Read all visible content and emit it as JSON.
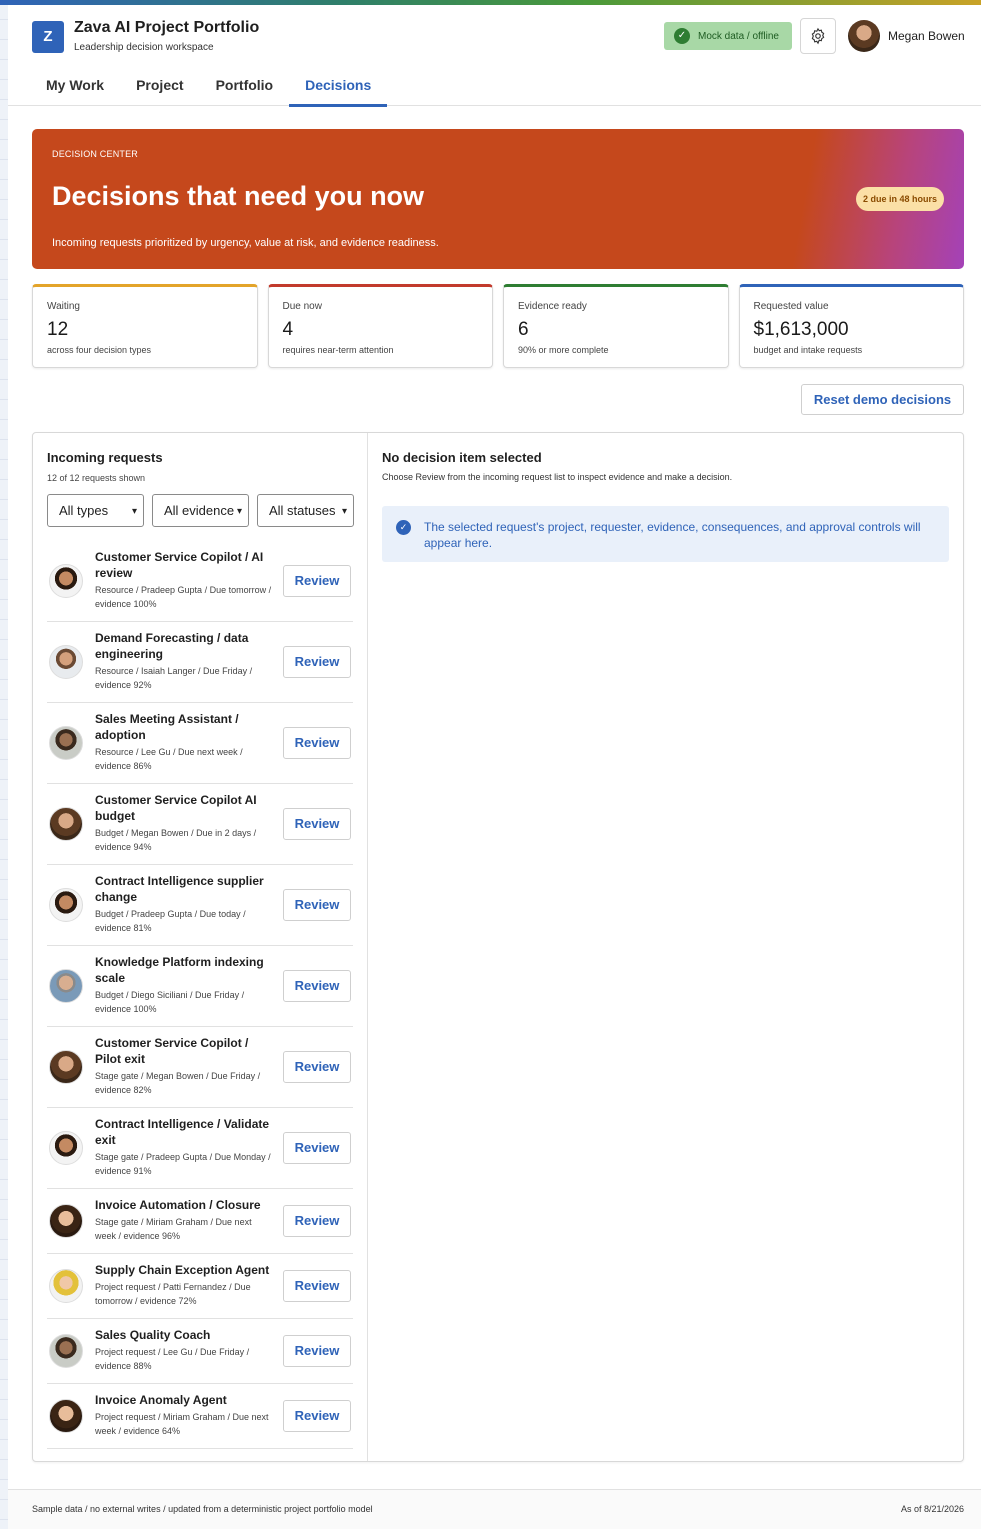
{
  "header": {
    "logo_letter": "Z",
    "title": "Zava AI Project Portfolio",
    "subtitle": "Leadership decision workspace",
    "mock_badge": "Mock data / offline",
    "user_name": "Megan Bowen"
  },
  "tabs": [
    {
      "label": "My Work"
    },
    {
      "label": "Project"
    },
    {
      "label": "Portfolio"
    },
    {
      "label": "Decisions"
    }
  ],
  "active_tab": "Decisions",
  "hero": {
    "kicker": "DECISION CENTER",
    "title": "Decisions that need you now",
    "description": "Incoming requests prioritized by urgency, value at risk, and evidence readiness.",
    "pill": "2 due in 48 hours"
  },
  "metrics": [
    {
      "label": "Waiting",
      "value": "12",
      "sub": "across four decision types",
      "color": "#e3a42a"
    },
    {
      "label": "Due now",
      "value": "4",
      "sub": "requires near-term attention",
      "color": "#c23a2c"
    },
    {
      "label": "Evidence ready",
      "value": "6",
      "sub": "90% or more complete",
      "color": "#2e7d32"
    },
    {
      "label": "Requested value",
      "value": "$1,613,000",
      "sub": "budget and intake requests",
      "color": "#2f63b8"
    }
  ],
  "reset_button": "Reset demo decisions",
  "requests_panel": {
    "title": "Incoming requests",
    "count": "12 of 12 requests shown",
    "filters": [
      "All types",
      "All evidence",
      "All statuses"
    ],
    "review_label": "Review",
    "items": [
      {
        "title": "Customer Service Copilot / AI review",
        "meta": "Resource / Pradeep Gupta / Due tomorrow / evidence 100%"
      },
      {
        "title": "Demand Forecasting / data engineering",
        "meta": "Resource / Isaiah Langer / Due Friday / evidence 92%"
      },
      {
        "title": "Sales Meeting Assistant / adoption",
        "meta": "Resource / Lee Gu / Due next week / evidence 86%"
      },
      {
        "title": "Customer Service Copilot AI budget",
        "meta": "Budget / Megan Bowen / Due in 2 days / evidence 94%"
      },
      {
        "title": "Contract Intelligence supplier change",
        "meta": "Budget / Pradeep Gupta / Due today / evidence 81%"
      },
      {
        "title": "Knowledge Platform indexing scale",
        "meta": "Budget / Diego Siciliani / Due Friday / evidence 100%"
      },
      {
        "title": "Customer Service Copilot / Pilot exit",
        "meta": "Stage gate / Megan Bowen / Due Friday / evidence 82%"
      },
      {
        "title": "Contract Intelligence / Validate exit",
        "meta": "Stage gate / Pradeep Gupta / Due Monday / evidence 91%"
      },
      {
        "title": "Invoice Automation / Closure",
        "meta": "Stage gate / Miriam Graham / Due next week / evidence 96%"
      },
      {
        "title": "Supply Chain Exception Agent",
        "meta": "Project request / Patti Fernandez / Due tomorrow / evidence 72%"
      },
      {
        "title": "Sales Quality Coach",
        "meta": "Project request / Lee Gu / Due Friday / evidence 88%"
      },
      {
        "title": "Invoice Anomaly Agent",
        "meta": "Project request / Miriam Graham / Due next week / evidence 64%"
      }
    ]
  },
  "detail_panel": {
    "title": "No decision item selected",
    "description": "Choose Review from the incoming request list to inspect evidence and make a decision.",
    "info": "The selected request's project, requester, evidence, consequences, and approval controls will appear here."
  },
  "footer": {
    "left": "Sample data / no external writes / updated from a deterministic project portfolio model",
    "right": "As of 8/21/2026"
  }
}
